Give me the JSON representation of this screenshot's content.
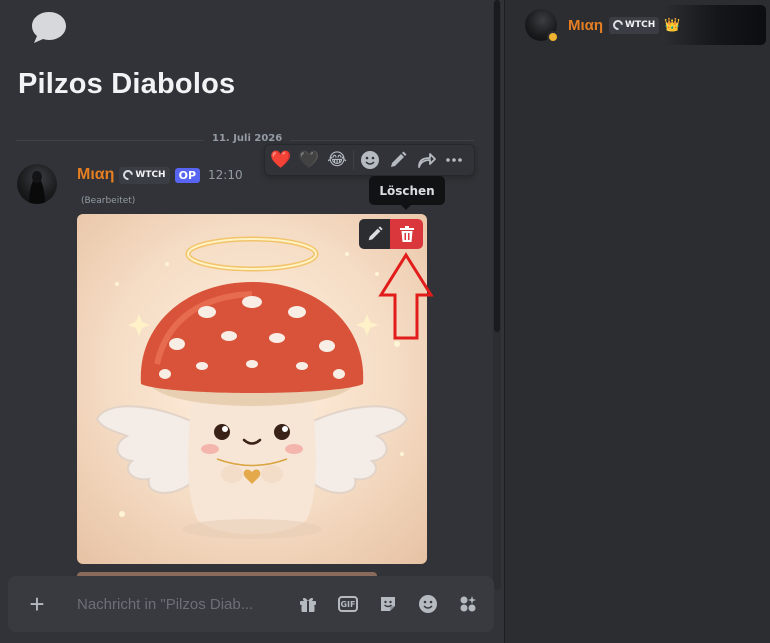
{
  "thread": {
    "title": "Pilzos Diabolos",
    "date_divider": "11. Juli 2026"
  },
  "message": {
    "author": "Μιαη",
    "tag": "WTCH",
    "op_badge": "OP",
    "time": "12:10",
    "edited": "(Bearbeitet)",
    "attachment": "angel-mushroom-image"
  },
  "toolbar": {
    "reactions": [
      "❤️",
      "🖤",
      "😂"
    ],
    "tooltip": "Löschen"
  },
  "composer": {
    "placeholder": "Nachricht in \"Pilzos Diab...",
    "gif_label": "GIF"
  },
  "members": [
    {
      "name": "Μιαη",
      "tag": "WTCH",
      "status": "idle",
      "crown": "👑"
    }
  ],
  "colors": {
    "accent_name": "#e67e22",
    "op_badge": "#5865f2",
    "delete": "#da373c",
    "annotation_arrow": "#e21b1b"
  }
}
